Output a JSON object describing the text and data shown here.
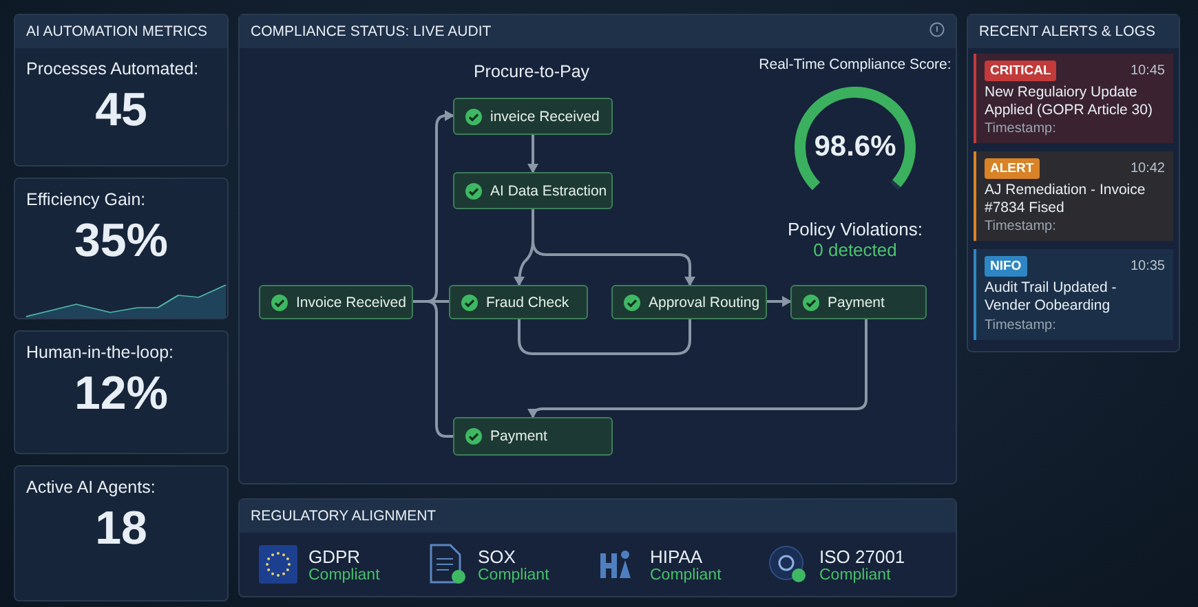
{
  "metrics": {
    "title": "AI AUTOMATION METRICS",
    "cards": [
      {
        "kind": "number",
        "label": "Processes Automated:",
        "value": "45"
      },
      {
        "kind": "trend",
        "label": "Efficiency Gain:",
        "value": "35%"
      },
      {
        "kind": "number",
        "label": "Human-in-the-loop:",
        "value": "12%"
      },
      {
        "kind": "number",
        "label": "Active AI Agents:",
        "value": "18"
      }
    ]
  },
  "compliance": {
    "title": "COMPLIANCE STATUS: LIVE AUDIT",
    "flow_title": "Procure-to-Pay",
    "nodes": [
      {
        "label": "inveice Received"
      },
      {
        "label": "AI Data Estraction"
      },
      {
        "label": "Invoice Received"
      },
      {
        "label": "Fraud Check"
      },
      {
        "label": "Approval Routing"
      },
      {
        "label": "Payment"
      },
      {
        "label": "Payment"
      }
    ],
    "score_label": "Real-Time Compliance Score:",
    "score": "98.6%",
    "level": 0.986,
    "violations_label": "Policy Violations:",
    "violations": "0 detected"
  },
  "alerts": {
    "title": "RECENT ALERTS & LOGS",
    "items": [
      {
        "kind": "critical",
        "tag": "CRITICAL",
        "time": "10:45",
        "message": "New Regulaiory Update Applied (GOPR Article 30)",
        "footer": "Timestamp:"
      },
      {
        "kind": "alert",
        "tag": "ALERT",
        "time": "10:42",
        "message": "AJ Remediation - Invoice #7834 Fised",
        "footer": "Timestamp:"
      },
      {
        "kind": "info",
        "tag": "NIFO",
        "time": "10:35",
        "message": "Audit Trail Updated - Vender Oobearding",
        "footer": "Timestamp:"
      }
    ]
  },
  "regulatory": {
    "title": "REGULATORY ALIGNMENT",
    "items": [
      {
        "kind": "flag",
        "name": "GDPR",
        "status": "Compliant"
      },
      {
        "kind": "document",
        "name": "SOX",
        "status": "Compliant"
      },
      {
        "kind": "health",
        "name": "HIPAA",
        "status": "Compliant"
      },
      {
        "kind": "globe",
        "name": "ISO 27001",
        "status": "Compliant"
      }
    ]
  }
}
